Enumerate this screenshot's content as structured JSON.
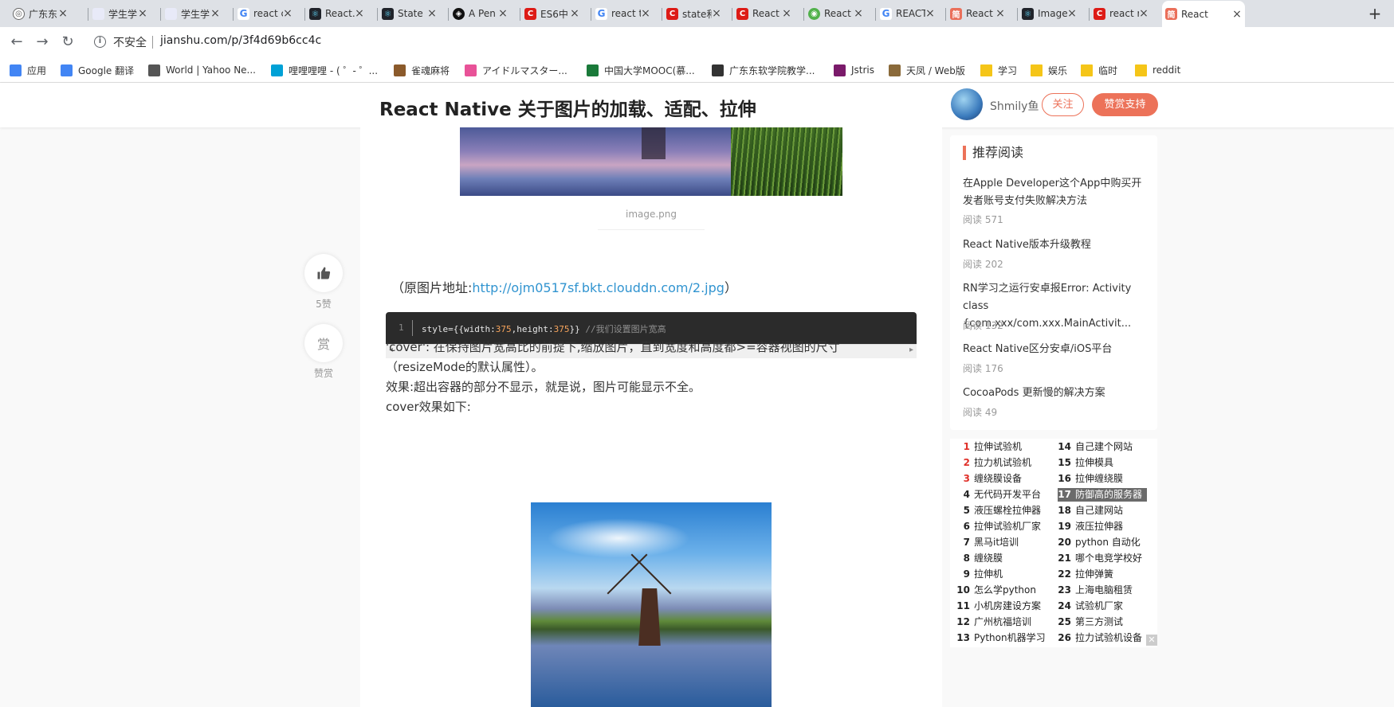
{
  "tabs": [
    {
      "label": "广东东",
      "icon": "globe-icon"
    },
    {
      "label": "学生学",
      "icon": "blank-page-icon"
    },
    {
      "label": "学生学",
      "icon": "blank-page-icon"
    },
    {
      "label": "react c",
      "icon": "google-icon"
    },
    {
      "label": "React.",
      "icon": "react-icon"
    },
    {
      "label": "State",
      "icon": "react-icon"
    },
    {
      "label": "A Pen",
      "icon": "codepen-icon"
    },
    {
      "label": "ES6中",
      "icon": "csdn-icon"
    },
    {
      "label": "react t",
      "icon": "google-icon"
    },
    {
      "label": "state和",
      "icon": "csdn-icon"
    },
    {
      "label": "React",
      "icon": "csdn-icon"
    },
    {
      "label": "React",
      "icon": "gamer-icon"
    },
    {
      "label": "REACT",
      "icon": "google-icon"
    },
    {
      "label": "React",
      "icon": "jianshu-icon"
    },
    {
      "label": "Image",
      "icon": "react-icon"
    },
    {
      "label": "react r",
      "icon": "csdn-icon"
    },
    {
      "label": "React",
      "icon": "jianshu-icon"
    }
  ],
  "toolbar": {
    "security": "不安全",
    "url": "jianshu.com/p/3f4d69b6cc4c"
  },
  "bookmarks": [
    {
      "label": "应用",
      "color": "#4285f4"
    },
    {
      "label": "Google 翻译",
      "color": "#4285f4"
    },
    {
      "label": "World | Yahoo Ne...",
      "color": "#555555"
    },
    {
      "label": "哩哩哩哩 - ( ゜- ゜...",
      "color": "#00a1d6"
    },
    {
      "label": "雀魂麻将",
      "color": "#8b5a2b"
    },
    {
      "label": "アイドルマスター...",
      "color": "#e85298"
    },
    {
      "label": "中国大学MOOC(慕...",
      "color": "#1a7a3a"
    },
    {
      "label": "广东东软学院教学...",
      "color": "#333333"
    },
    {
      "label": "Jstris",
      "color": "#7a1a6a"
    },
    {
      "label": "天凤 / Web版",
      "color": "#8a6a3a"
    },
    {
      "label": "学习",
      "color": "#f5c518"
    },
    {
      "label": "娱乐",
      "color": "#f5c518"
    },
    {
      "label": "临时",
      "color": "#f5c518"
    },
    {
      "label": "reddit",
      "color": "#f5c518"
    }
  ],
  "header": {
    "title": "React Native 关于图片的加载、适配、拉伸",
    "author": "Shmily鱼",
    "follow": "关注",
    "reward": "赞赏支持"
  },
  "article": {
    "caption": "image.png",
    "source_prefix": "（原图片地址:",
    "source_link": "http://ojm0517sf.bkt.clouddn.com/2.jpg",
    "source_suffix": "）",
    "code_line_no": "1",
    "code_a": "style={{width:",
    "code_n1": "375",
    "code_b": ",height:",
    "code_n2": "375",
    "code_c": "}}",
    "code_comment": "//我们设置图片宽高",
    "para1": "'cover': 在保持图片宽高比的前提下,缩放图片，直到宽度和高度都>=容器视图的尺寸",
    "para2": "（resizeMode的默认属性）。",
    "para3": "效果:超出容器的部分不显示，就是说，图片可能显示不全。",
    "para4": "cover效果如下:"
  },
  "side_actions": {
    "like_count": "5赞",
    "reward_icon": "赏",
    "reward_label": "赞赏"
  },
  "recommend": {
    "title": "推荐阅读",
    "items": [
      {
        "line1": "在Apple Developer这个App中购买开",
        "line2": "发者账号支付失败解决方法",
        "reads": "阅读 571"
      },
      {
        "line1": "React Native版本升级教程",
        "line2": "",
        "reads": "阅读 202"
      },
      {
        "line1": "RN学习之运行安卓报Error: Activity",
        "line2": "class {com.xxx/com.xxx.MainActivit...",
        "reads": "阅读 132"
      },
      {
        "line1": "React Native区分安卓/iOS平台",
        "line2": "",
        "reads": "阅读 176"
      },
      {
        "line1": "CocoaPods 更新慢的解决方案",
        "line2": "",
        "reads": "阅读 49"
      }
    ]
  },
  "ad_list": [
    {
      "n": "1",
      "text": "拉伸试验机"
    },
    {
      "n": "14",
      "text": "自己建个网站"
    },
    {
      "n": "2",
      "text": "拉力机试验机"
    },
    {
      "n": "15",
      "text": "拉伸模具"
    },
    {
      "n": "3",
      "text": "缠绕膜设备"
    },
    {
      "n": "16",
      "text": "拉伸缠绕膜"
    },
    {
      "n": "4",
      "text": "无代码开发平台"
    },
    {
      "n": "17",
      "text": "防御高的服务器"
    },
    {
      "n": "5",
      "text": "液压螺栓拉伸器"
    },
    {
      "n": "18",
      "text": "自己建网站"
    },
    {
      "n": "6",
      "text": "拉伸试验机厂家"
    },
    {
      "n": "19",
      "text": "液压拉伸器"
    },
    {
      "n": "7",
      "text": "黑马it培训"
    },
    {
      "n": "20",
      "text": "python 自动化"
    },
    {
      "n": "8",
      "text": "缠绕膜"
    },
    {
      "n": "21",
      "text": "哪个电竞学校好"
    },
    {
      "n": "9",
      "text": "拉伸机"
    },
    {
      "n": "22",
      "text": "拉伸弹簧"
    },
    {
      "n": "10",
      "text": "怎么学python"
    },
    {
      "n": "23",
      "text": "上海电脑租赁"
    },
    {
      "n": "11",
      "text": "小机房建设方案"
    },
    {
      "n": "24",
      "text": "试验机厂家"
    },
    {
      "n": "12",
      "text": "广州杭福培训"
    },
    {
      "n": "25",
      "text": "第三方测试"
    },
    {
      "n": "13",
      "text": "Python机器学习"
    },
    {
      "n": "26",
      "text": "拉力试验机设备"
    }
  ]
}
